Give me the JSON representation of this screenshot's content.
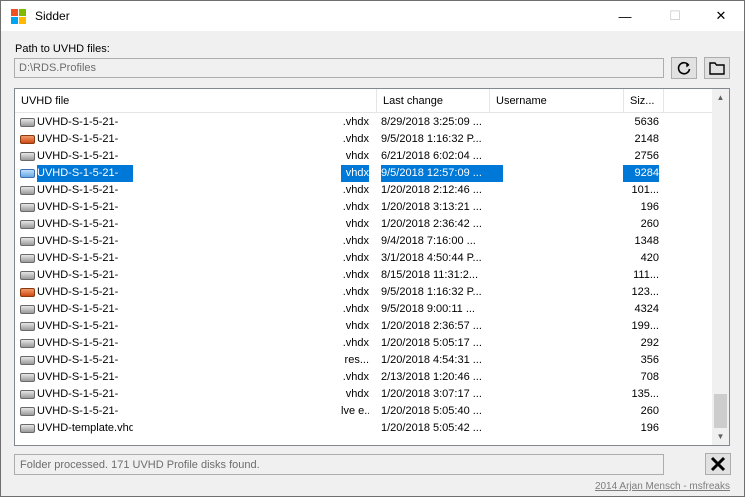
{
  "window": {
    "title": "Sidder",
    "minimize": "—",
    "maximize": "☐",
    "close": "✕"
  },
  "path": {
    "label": "Path to UVHD files:",
    "value": "D:\\RDS.Profiles"
  },
  "buttons": {
    "refresh_icon": "refresh-icon",
    "folder_icon": "folder-icon",
    "close_icon": "close-x-icon"
  },
  "table": {
    "columns": [
      "UVHD file",
      "Last change",
      "Username",
      "Siz..."
    ],
    "rows": [
      {
        "name": "UVHD-S-1-5-21-",
        "ext": ".vhdx",
        "date": "8/29/2018 3:25:09 ...",
        "size": "5636",
        "icon": "gray"
      },
      {
        "name": "UVHD-S-1-5-21-",
        "ext": ".vhdx",
        "date": "9/5/2018 1:16:32 P...",
        "size": "2148",
        "icon": "orange"
      },
      {
        "name": "UVHD-S-1-5-21-",
        "ext": "vhdx",
        "date": "6/21/2018 6:02:04 ...",
        "size": "2756",
        "icon": "gray"
      },
      {
        "name": "UVHD-S-1-5-21-",
        "ext": "vhdx",
        "date": "9/5/2018 12:57:09 ...",
        "size": "9284",
        "icon": "blue",
        "selected": true
      },
      {
        "name": "UVHD-S-1-5-21-",
        "ext": ".vhdx",
        "date": "1/20/2018 2:12:46 ...",
        "size": "101...",
        "icon": "gray"
      },
      {
        "name": "UVHD-S-1-5-21-",
        "ext": ".vhdx",
        "date": "1/20/2018 3:13:21 ...",
        "size": "196",
        "icon": "gray"
      },
      {
        "name": "UVHD-S-1-5-21-",
        "ext": "vhdx",
        "date": "1/20/2018 2:36:42 ...",
        "size": "260",
        "icon": "gray"
      },
      {
        "name": "UVHD-S-1-5-21-",
        "ext": ".vhdx",
        "date": "9/4/2018 7:16:00 ...",
        "size": "1348",
        "icon": "gray"
      },
      {
        "name": "UVHD-S-1-5-21-",
        "ext": ".vhdx",
        "date": "3/1/2018 4:50:44 P...",
        "size": "420",
        "icon": "gray"
      },
      {
        "name": "UVHD-S-1-5-21-",
        "ext": ".vhdx",
        "date": "8/15/2018 11:31:2...",
        "size": "111...",
        "icon": "gray"
      },
      {
        "name": "UVHD-S-1-5-21-",
        "ext": ".vhdx",
        "date": "9/5/2018 1:16:32 P...",
        "size": "123...",
        "icon": "orange"
      },
      {
        "name": "UVHD-S-1-5-21-",
        "ext": ".vhdx",
        "date": "9/5/2018 9:00:11 ...",
        "size": "4324",
        "icon": "gray"
      },
      {
        "name": "UVHD-S-1-5-21-",
        "ext": "vhdx",
        "date": "1/20/2018 2:36:57 ...",
        "size": "199...",
        "icon": "gray"
      },
      {
        "name": "UVHD-S-1-5-21-",
        "ext": ".vhdx",
        "date": "1/20/2018 5:05:17 ...",
        "size": "292",
        "icon": "gray"
      },
      {
        "name": "UVHD-S-1-5-21-",
        "ext": "res...",
        "date": "1/20/2018 4:54:31 ...",
        "size": "356",
        "icon": "gray"
      },
      {
        "name": "UVHD-S-1-5-21-",
        "ext": ".vhdx",
        "date": "2/13/2018 1:20:46 ...",
        "size": "708",
        "icon": "gray"
      },
      {
        "name": "UVHD-S-1-5-21-",
        "ext": "vhdx",
        "date": "1/20/2018 3:07:17 ...",
        "size": "135...",
        "icon": "gray"
      },
      {
        "name": "UVHD-S-1-5-21-",
        "ext": "lve e...",
        "date": "1/20/2018 5:05:40 ...",
        "size": "260",
        "icon": "gray"
      },
      {
        "name": "UVHD-template.vhdx",
        "ext": "",
        "date": "1/20/2018 5:05:42 ...",
        "size": "196",
        "icon": "gray"
      }
    ]
  },
  "status": "Folder processed. 171 UVHD Profile disks found.",
  "footer": "2014 Arjan Mensch - msfreaks"
}
